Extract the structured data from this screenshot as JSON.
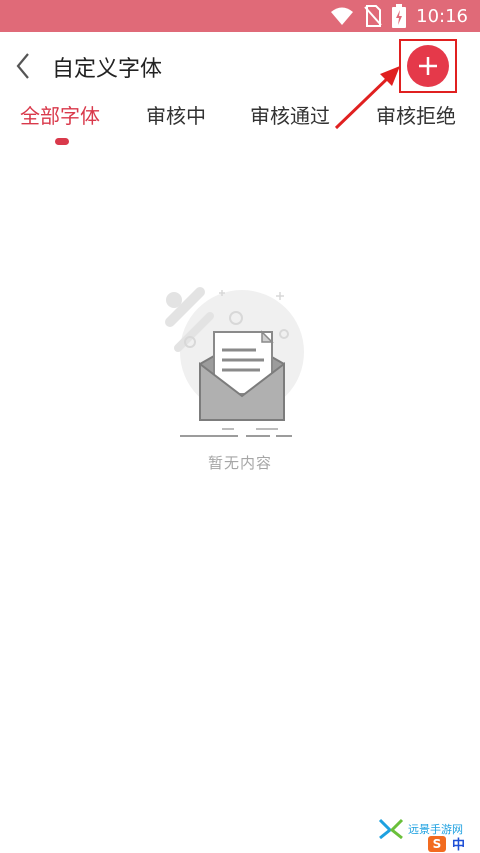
{
  "status_bar": {
    "time": "10:16",
    "icons": [
      "wifi-icon",
      "no-sim-icon",
      "battery-charging-icon"
    ],
    "color": "#e06a78"
  },
  "header": {
    "title": "自定义字体",
    "back_icon": "chevron-left-icon",
    "add_icon": "plus-icon",
    "accent_color": "#e5394a"
  },
  "tabs": [
    {
      "label": "全部字体",
      "active": true
    },
    {
      "label": "审核中",
      "active": false
    },
    {
      "label": "审核通过",
      "active": false
    },
    {
      "label": "审核拒绝",
      "active": false
    }
  ],
  "empty_state": {
    "text": "暂无内容",
    "icon": "empty-envelope-icon"
  },
  "watermark": {
    "text": "远景手游网"
  },
  "ime": {
    "logo": "S",
    "mode": "中"
  }
}
